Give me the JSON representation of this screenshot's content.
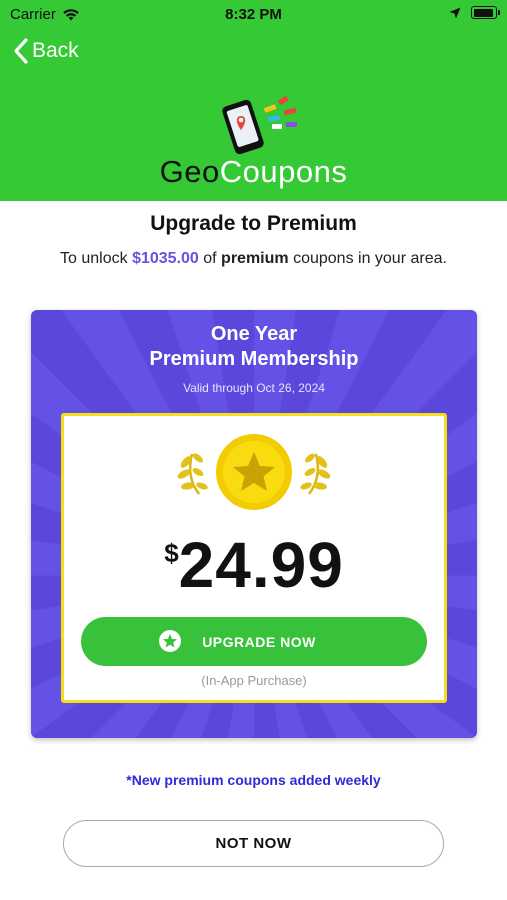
{
  "status_bar": {
    "carrier": "Carrier",
    "time": "8:32 PM"
  },
  "nav": {
    "back_label": "Back"
  },
  "logo": {
    "part1": "Geo",
    "part2": "Coupons"
  },
  "title": "Upgrade to Premium",
  "subtitle": {
    "prefix": "To unlock ",
    "amount": "$1035.00",
    "middle": " of ",
    "emphasis": "premium",
    "suffix": " coupons in your area."
  },
  "offer": {
    "title_line1": "One Year",
    "title_line2": "Premium Membership",
    "valid_text": "Valid through Oct 26, 2024",
    "currency": "$",
    "price": "24.99",
    "button_label": "UPGRADE NOW",
    "purchase_note": "(In-App Purchase)"
  },
  "footnote": "*New premium coupons added weekly",
  "dismiss_label": "NOT NOW",
  "colors": {
    "header_green": "#36c936",
    "card_purple": "#6451e6",
    "accent_purple": "#6553e0",
    "button_green": "#38c23b",
    "gold": "#f6df1a",
    "note_blue": "#2e2bd6"
  },
  "icons": [
    "wifi-icon",
    "back-chevron-icon",
    "location-arrow-icon",
    "battery-icon",
    "phone-map-logo-icon",
    "star-medal-icon",
    "laurel-icon",
    "star-badge-icon"
  ]
}
